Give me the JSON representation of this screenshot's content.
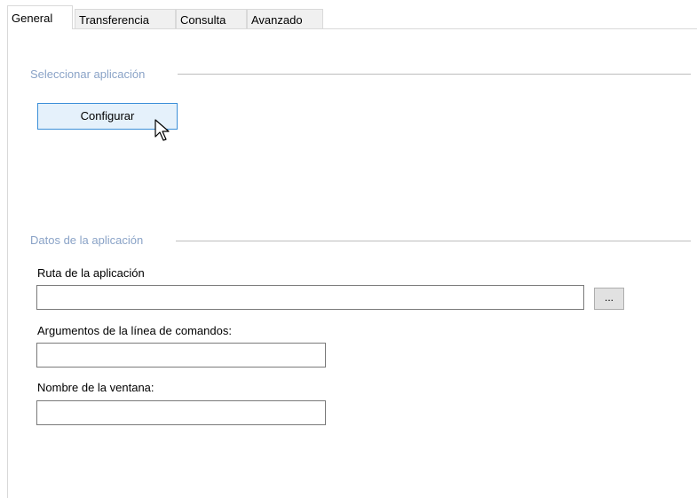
{
  "tabs": [
    {
      "label": "General",
      "active": true
    },
    {
      "label": "Transferencia",
      "active": false
    },
    {
      "label": "Consulta",
      "active": false
    },
    {
      "label": "Avanzado",
      "active": false
    }
  ],
  "select_group": {
    "title": "Seleccionar aplicación",
    "configure_button": "Configurar"
  },
  "data_group": {
    "title": "Datos de la aplicación",
    "path_label": "Ruta de la aplicación",
    "path_value": "",
    "browse_button": "...",
    "args_label": "Argumentos de la línea de comandos:",
    "args_value": "",
    "window_label": "Nombre de la ventana:",
    "window_value": ""
  },
  "colors": {
    "group_title": "#8aa3c7",
    "button_focus_border": "#3c8fd8",
    "button_focus_bg": "#e5f1fb"
  },
  "icons": {
    "cursor": "mouse-pointer-icon"
  }
}
